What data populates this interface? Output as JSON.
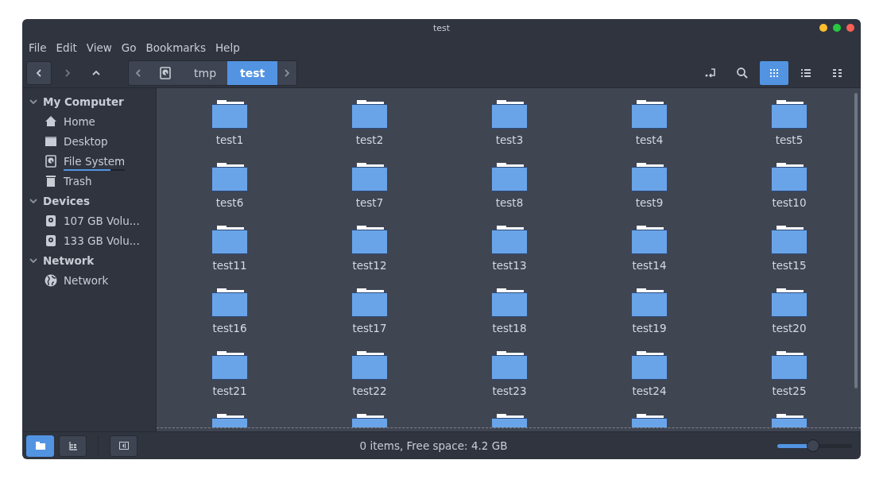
{
  "window": {
    "title": "test"
  },
  "menu": [
    "File",
    "Edit",
    "View",
    "Go",
    "Bookmarks",
    "Help"
  ],
  "toolbar": {
    "back_disabled": false,
    "forward_disabled": true,
    "breadcrumb": [
      {
        "kind": "drive",
        "selected": false
      },
      {
        "label": "tmp",
        "kind": "text",
        "selected": false
      },
      {
        "label": "test",
        "kind": "text",
        "selected": true
      }
    ],
    "views": [
      {
        "kind": "icons",
        "selected": true
      },
      {
        "kind": "list",
        "selected": false
      },
      {
        "kind": "compact",
        "selected": false
      }
    ]
  },
  "sidebar": [
    {
      "label": "My Computer",
      "expanded": true,
      "children": [
        {
          "label": "Home",
          "kind": "home"
        },
        {
          "label": "Desktop",
          "kind": "desktop"
        },
        {
          "label": "File System",
          "kind": "filesystem",
          "level": 0.77
        },
        {
          "label": "Trash",
          "kind": "trash"
        }
      ]
    },
    {
      "label": "Devices",
      "expanded": true,
      "children": [
        {
          "label": "107 GB Volu...",
          "kind": "drive"
        },
        {
          "label": "133 GB Volu...",
          "kind": "drive"
        }
      ]
    },
    {
      "label": "Network",
      "expanded": true,
      "children": [
        {
          "label": "Network",
          "kind": "network"
        }
      ]
    }
  ],
  "items": [
    {
      "name": "test1",
      "kind": "folder"
    },
    {
      "name": "test2",
      "kind": "folder"
    },
    {
      "name": "test3",
      "kind": "folder"
    },
    {
      "name": "test4",
      "kind": "folder"
    },
    {
      "name": "test5",
      "kind": "folder"
    },
    {
      "name": "test6",
      "kind": "folder"
    },
    {
      "name": "test7",
      "kind": "folder"
    },
    {
      "name": "test8",
      "kind": "folder"
    },
    {
      "name": "test9",
      "kind": "folder"
    },
    {
      "name": "test10",
      "kind": "folder"
    },
    {
      "name": "test11",
      "kind": "folder"
    },
    {
      "name": "test12",
      "kind": "folder"
    },
    {
      "name": "test13",
      "kind": "folder"
    },
    {
      "name": "test14",
      "kind": "folder"
    },
    {
      "name": "test15",
      "kind": "folder"
    },
    {
      "name": "test16",
      "kind": "folder"
    },
    {
      "name": "test17",
      "kind": "folder"
    },
    {
      "name": "test18",
      "kind": "folder"
    },
    {
      "name": "test19",
      "kind": "folder"
    },
    {
      "name": "test20",
      "kind": "folder"
    },
    {
      "name": "test21",
      "kind": "folder"
    },
    {
      "name": "test22",
      "kind": "folder"
    },
    {
      "name": "test23",
      "kind": "folder"
    },
    {
      "name": "test24",
      "kind": "folder"
    },
    {
      "name": "test25",
      "kind": "folder"
    },
    {
      "kind": "partial"
    },
    {
      "kind": "partial"
    },
    {
      "kind": "partial"
    },
    {
      "kind": "partial"
    },
    {
      "kind": "partial"
    }
  ],
  "status_bar": {
    "panes": [
      {
        "kind": "places",
        "selected": true
      },
      {
        "kind": "tree",
        "selected": false
      }
    ],
    "text": "0 items, Free space: 4.2 GB",
    "zoom": {
      "level": 0.49
    }
  }
}
